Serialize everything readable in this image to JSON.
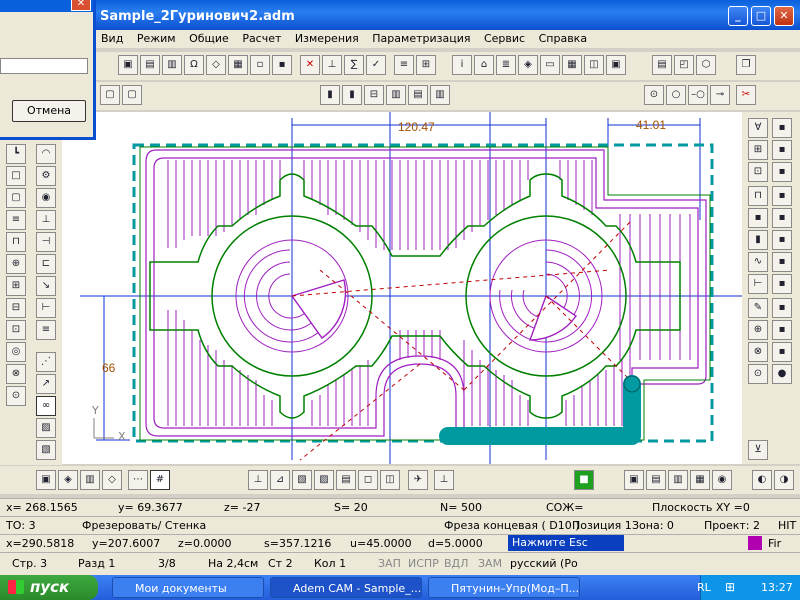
{
  "window": {
    "title": "Sample_2Гуринович2.adm"
  },
  "menu": [
    "Вид",
    "Режим",
    "Общие",
    "Расчет",
    "Измерения",
    "Параметризация",
    "Сервис",
    "Справка"
  ],
  "dialog": {
    "cancel_label": "Отмена"
  },
  "drawing": {
    "dim_top": "120.47",
    "dim_right": "41.01",
    "dim_left": "66",
    "axis_y": "Y",
    "axis_x": "X"
  },
  "status1": {
    "x": "x= 268.1565",
    "y": "y= 69.3677",
    "z": "z= -27",
    "s": "S= 20",
    "n": "N= 500",
    "coolant": "СОЖ=",
    "plane": "Плоскость  XY =0"
  },
  "status2": {
    "to": "ТО: 3",
    "op": "Фрезеровать/ Стенка",
    "tool": "Фреза концевая ( D10 )",
    "pos": "Позиция 1",
    "zone": "Зона: 0",
    "project": "Проект: 2",
    "hit": "HIT"
  },
  "status3": {
    "x": "x=290.5818",
    "y": "y=207.6007",
    "z": "z=0.0000",
    "s": "s=357.1216",
    "u": "u=45.0000",
    "d": "d=5.0000",
    "hint": "Нажмите Esc",
    "fir": "Fir"
  },
  "word_status": {
    "page": "Стр.  3",
    "section": "Разд  1",
    "pages": "3/8",
    "at": "На  2,4см",
    "line": "Ст  2",
    "col": "Кол  1",
    "rec": "ЗАП",
    "trk": "ИСПР",
    "ext": "ВДЛ",
    "ovr": "ЗАМ",
    "lang": "русский (Ро"
  },
  "taskbar": {
    "start": "пуск",
    "tasks": [
      "Мои документы",
      "Adem CAM - Sample_...",
      "Пятунин–Упр(Мод–П..."
    ],
    "lang": "RL",
    "time": "13:27"
  },
  "colors": {
    "contour": "#a020c0",
    "path": "#008000",
    "dim": "#1030d0",
    "tool": "#009aa0"
  }
}
